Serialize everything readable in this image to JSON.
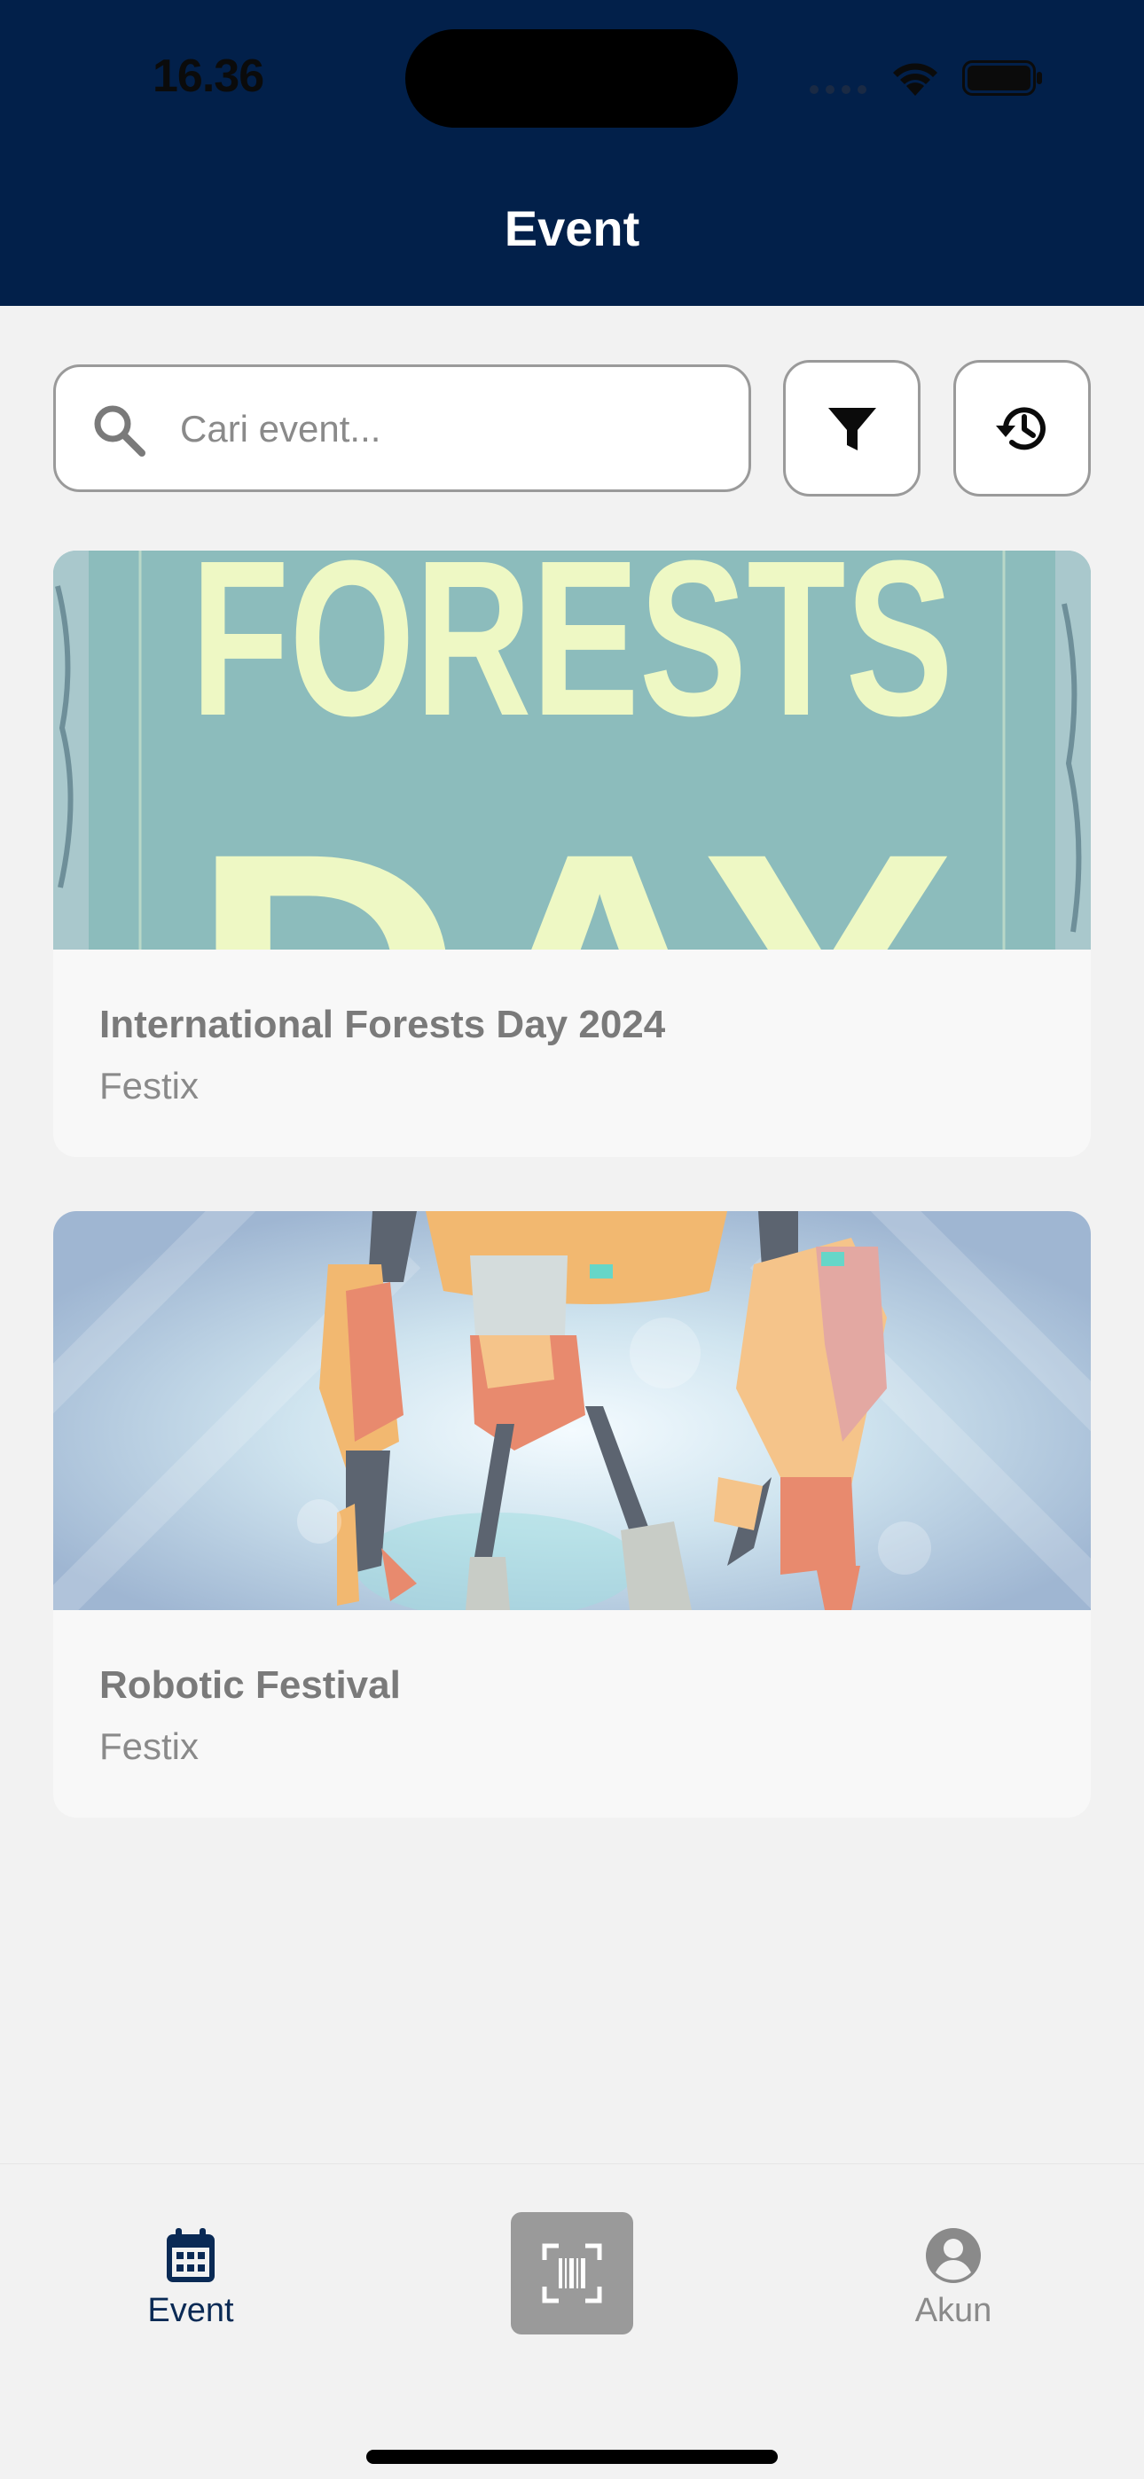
{
  "status_bar": {
    "time": "16.36",
    "icons": [
      "cellular-signal-icon",
      "wifi-icon",
      "battery-icon"
    ]
  },
  "header": {
    "title": "Event",
    "background_color": "#02204a"
  },
  "search": {
    "placeholder": "Cari event...",
    "value": "",
    "icon": "search-icon"
  },
  "toolbar": {
    "filter_icon": "filter-icon",
    "history_icon": "history-icon"
  },
  "events": [
    {
      "title": "International Forests Day 2024",
      "organizer": "Festix",
      "banner_text": [
        "FORESTS",
        "DAY"
      ]
    },
    {
      "title": "Robotic Festival",
      "organizer": "Festix"
    }
  ],
  "bottom_nav": {
    "items": [
      {
        "label": "Event",
        "icon": "calendar-icon",
        "active": true
      },
      {
        "label": "",
        "icon": "barcode-scan-icon",
        "active": false
      },
      {
        "label": "Akun",
        "icon": "account-icon",
        "active": false
      }
    ],
    "active_color": "#0a2a55",
    "inactive_color": "#8a8a8a"
  }
}
